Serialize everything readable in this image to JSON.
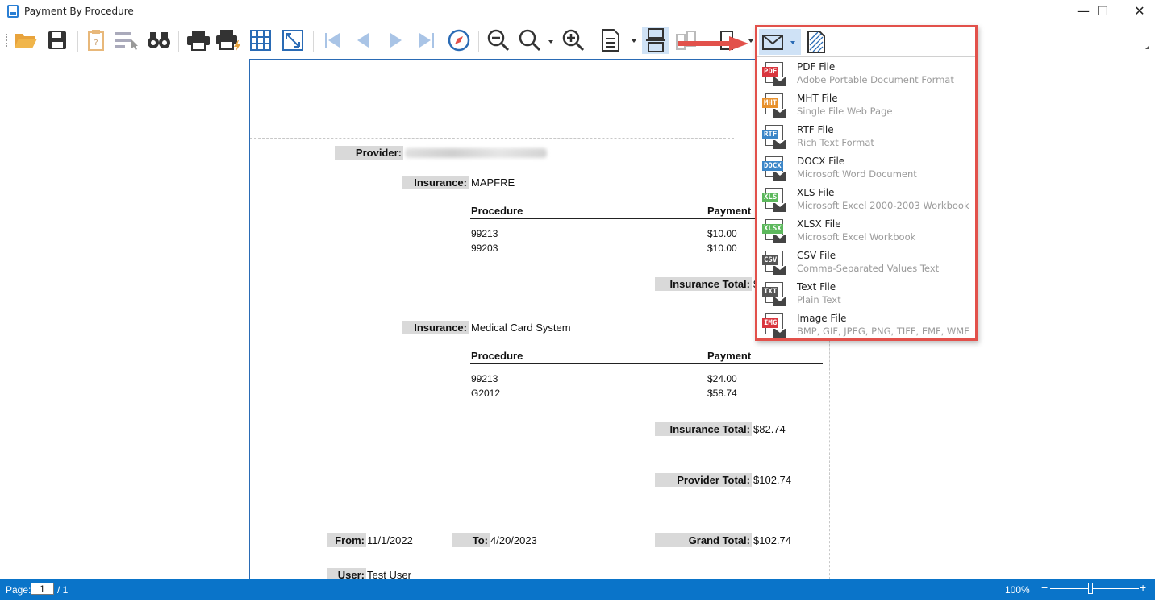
{
  "window": {
    "title": "Payment By Procedure",
    "minimize": "—",
    "maximize": "☐",
    "close": "✕"
  },
  "report": {
    "provider_label": "Provider:",
    "groups": [
      {
        "insurance_label": "Insurance:",
        "insurance_name": "MAPFRE",
        "col_procedure": "Procedure",
        "col_payment": "Payment",
        "rows": [
          {
            "procedure": "99213",
            "payment": "$10.00"
          },
          {
            "procedure": "99203",
            "payment": "$10.00"
          }
        ],
        "total_label": "Insurance Total:",
        "total_value": "$"
      },
      {
        "insurance_label": "Insurance:",
        "insurance_name": "Medical Card System",
        "col_procedure": "Procedure",
        "col_payment": "Payment",
        "rows": [
          {
            "procedure": "99213",
            "payment": "$24.00"
          },
          {
            "procedure": "G2012",
            "payment": "$58.74"
          }
        ],
        "total_label": "Insurance Total:",
        "total_value": "$82.74"
      }
    ],
    "provider_total_label": "Provider Total:",
    "provider_total_value": "$102.74",
    "from_label": "From:",
    "from_value": "11/1/2022",
    "to_label": "To:",
    "to_value": "4/20/2023",
    "grand_total_label": "Grand Total:",
    "grand_total_value": "$102.74",
    "user_label": "User:",
    "user_value": "Test User"
  },
  "export_menu": {
    "items": [
      {
        "title": "PDF File",
        "subtitle": "Adobe Portable Document Format",
        "badge": "PDF",
        "color": "#d9363e"
      },
      {
        "title": "MHT File",
        "subtitle": "Single File Web Page",
        "badge": "MHT",
        "color": "#e8912d"
      },
      {
        "title": "RTF File",
        "subtitle": "Rich Text Format",
        "badge": "RTF",
        "color": "#3b86c8"
      },
      {
        "title": "DOCX File",
        "subtitle": "Microsoft Word Document",
        "badge": "DOCX",
        "color": "#3b86c8"
      },
      {
        "title": "XLS File",
        "subtitle": "Microsoft Excel 2000-2003 Workbook",
        "badge": "XLS",
        "color": "#5cb85c"
      },
      {
        "title": "XLSX File",
        "subtitle": "Microsoft Excel Workbook",
        "badge": "XLSX",
        "color": "#5cb85c"
      },
      {
        "title": "CSV File",
        "subtitle": "Comma-Separated Values Text",
        "badge": "CSV",
        "color": "#555555"
      },
      {
        "title": "Text File",
        "subtitle": "Plain Text",
        "badge": "TXT",
        "color": "#555555"
      },
      {
        "title": "Image File",
        "subtitle": "BMP, GIF, JPEG, PNG, TIFF, EMF, WMF",
        "badge": "IMG",
        "color": "#d9363e"
      }
    ]
  },
  "status": {
    "page_label": "Page:",
    "page_value": "1",
    "page_total": "/ 1",
    "zoom": "100%",
    "zoom_level_fraction": 0.45
  },
  "colors": {
    "accent": "#0a74c9",
    "highlight": "#e2514b",
    "label_bg": "#d9d9d9"
  },
  "icons": [
    "open-folder-icon",
    "save-icon",
    "clipboard-icon",
    "parameters-icon",
    "binoculars-icon",
    "print-icon",
    "quick-print-icon",
    "page-setup-icon",
    "fit-page-icon",
    "first-page-icon",
    "prev-page-icon",
    "next-page-icon",
    "last-page-icon",
    "navigate-icon",
    "zoom-out-icon",
    "zoom-icon",
    "zoom-in-icon",
    "document-icon",
    "multipage-icon",
    "pages-icon",
    "export-icon",
    "email-icon",
    "watermark-icon"
  ]
}
